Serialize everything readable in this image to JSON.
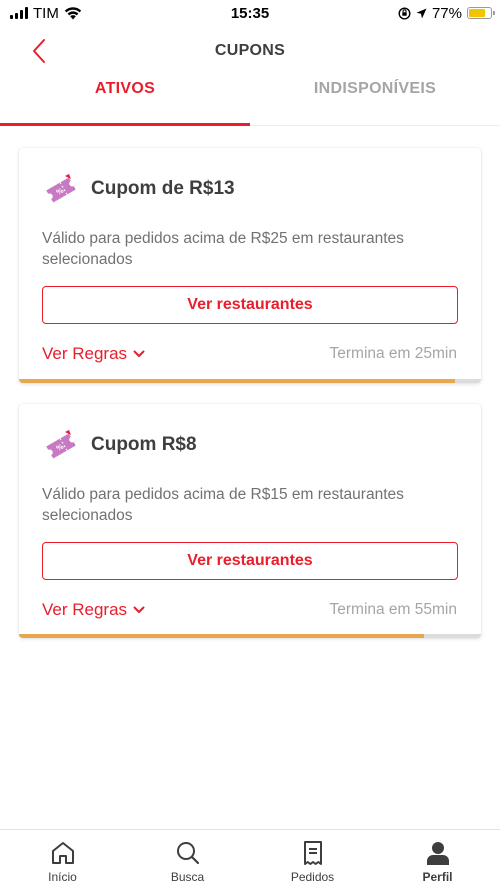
{
  "status_bar": {
    "carrier": "TIM",
    "time": "15:35",
    "battery": "77%",
    "battery_level": 0.77
  },
  "header": {
    "title": "CUPONS"
  },
  "tabs": [
    {
      "label": "ATIVOS",
      "active": true
    },
    {
      "label": "INDISPONÍVEIS",
      "active": false
    }
  ],
  "coupons": [
    {
      "title": "Cupom de R$13",
      "description": "Válido para pedidos acima de R$25 em restaurantes selecionados",
      "button_label": "Ver restaurantes",
      "rules_label": "Ver Regras",
      "expires": "Termina em 25min",
      "progress": 0.943
    },
    {
      "title": "Cupom R$8",
      "description": "Válido para pedidos acima de R$15 em restaurantes selecionados",
      "button_label": "Ver restaurantes",
      "rules_label": "Ver Regras",
      "expires": "Termina em 55min",
      "progress": 0.877
    }
  ],
  "bottom_nav": [
    {
      "label": "Início",
      "icon": "home-icon"
    },
    {
      "label": "Busca",
      "icon": "search-icon"
    },
    {
      "label": "Pedidos",
      "icon": "receipt-icon"
    },
    {
      "label": "Perfil",
      "icon": "profile-icon",
      "active": true
    }
  ],
  "colors": {
    "accent": "#ea1d2c",
    "progress": "#e7a74e",
    "coupon_icon": "#c879c4"
  }
}
